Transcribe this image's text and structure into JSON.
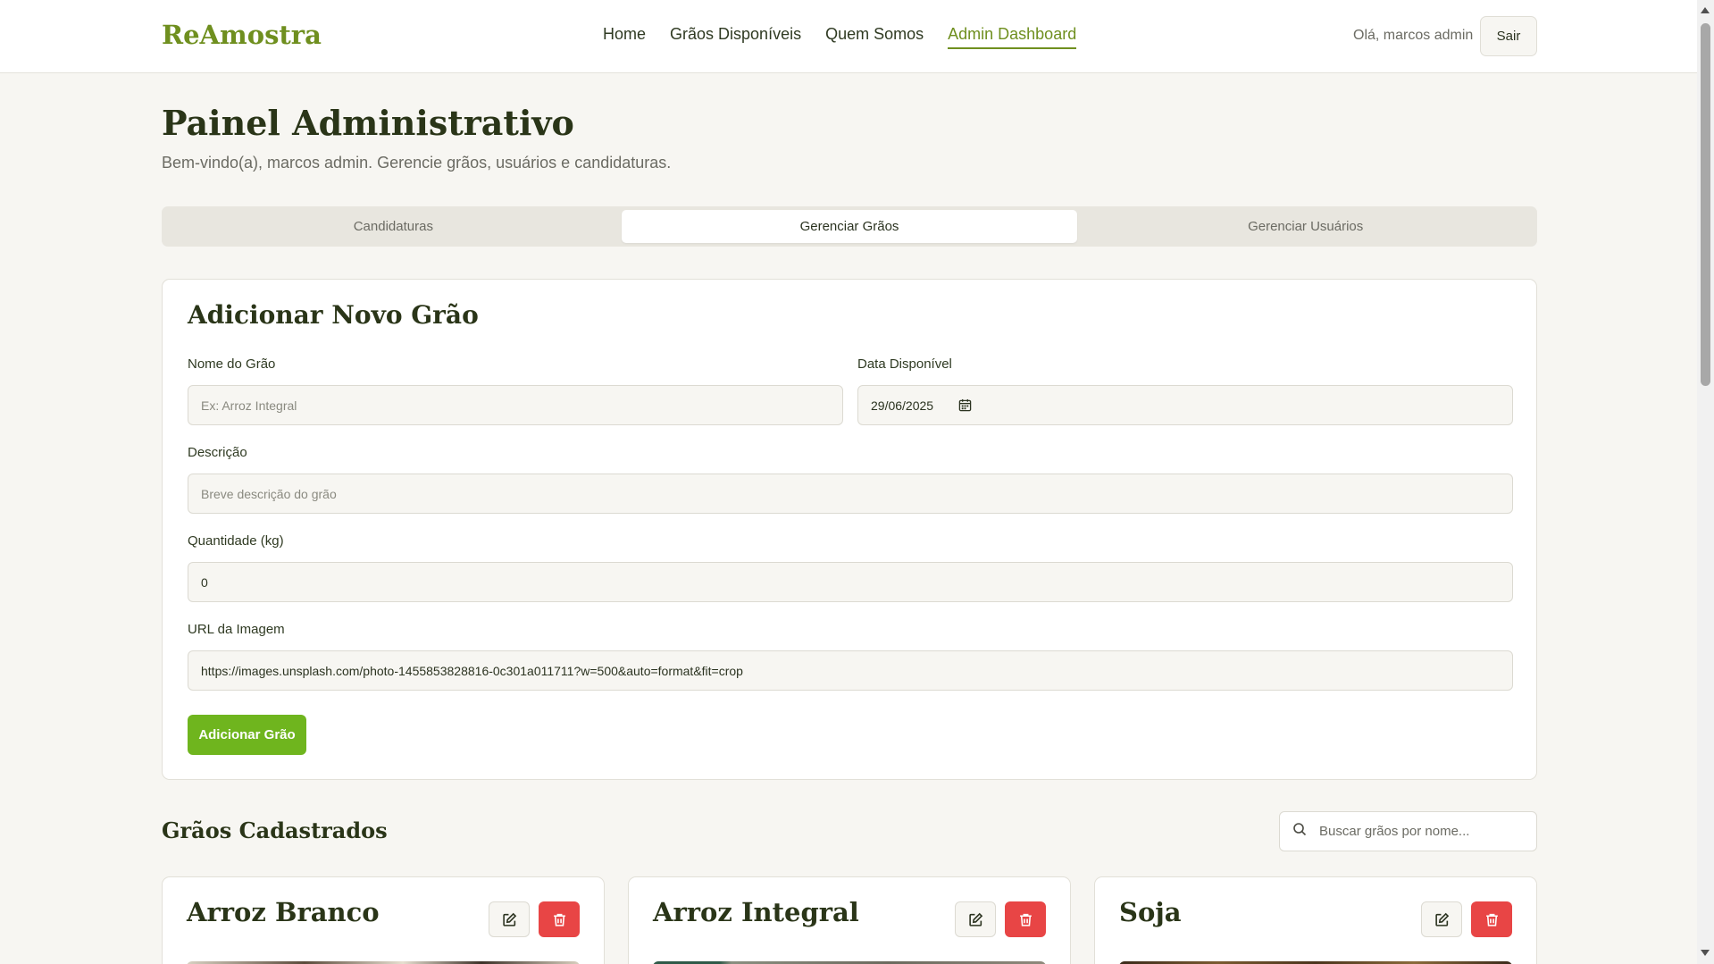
{
  "header": {
    "logo": "ReAmostra",
    "nav": [
      "Home",
      "Grãos Disponíveis",
      "Quem Somos",
      "Admin Dashboard"
    ],
    "active_nav": "Admin Dashboard",
    "greeting": "Olá, marcos admin",
    "logout": "Sair"
  },
  "page": {
    "title": "Painel Administrativo",
    "subtitle": "Bem-vindo(a), marcos admin. Gerencie grãos, usuários e candidaturas."
  },
  "tabs": [
    "Candidaturas",
    "Gerenciar Grãos",
    "Gerenciar Usuários"
  ],
  "active_tab": "Gerenciar Grãos",
  "form": {
    "title": "Adicionar Novo Grão",
    "name_label": "Nome do Grão",
    "name_placeholder": "Ex: Arroz Integral",
    "date_label": "Data Disponível",
    "date_value": "29/06/2025",
    "desc_label": "Descrição",
    "desc_placeholder": "Breve descrição do grão",
    "qty_label": "Quantidade (kg)",
    "qty_value": "0",
    "url_label": "URL da Imagem",
    "url_value": "https://images.unsplash.com/photo-1455853828816-0c301a011711?w=500&auto=format&fit=crop",
    "submit": "Adicionar Grão"
  },
  "grains": {
    "title": "Grãos Cadastrados",
    "search_placeholder": "Buscar grãos por nome...",
    "items": [
      {
        "name": "Arroz Branco"
      },
      {
        "name": "Arroz Integral"
      },
      {
        "name": "Soja"
      }
    ]
  },
  "colors": {
    "accent": "#6f8f1f",
    "primary_button": "#6fb51e",
    "danger": "#e84545"
  }
}
